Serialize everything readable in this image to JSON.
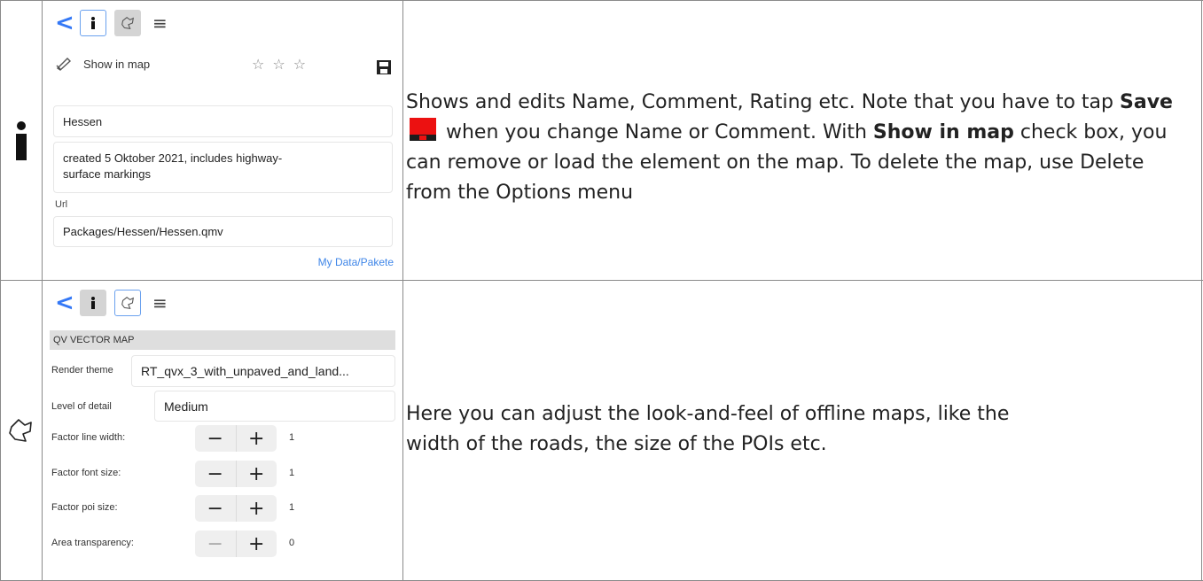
{
  "row1": {
    "toolbar": {
      "back": "<"
    },
    "show_in_map": "Show in map",
    "stars": [
      "☆",
      "☆",
      "☆"
    ],
    "name": "Hessen",
    "comment": "created 5 Oktober 2021, includes highway-surface markings",
    "url_label": "Url",
    "url": "Packages/Hessen/Hessen.qmv",
    "folder_link": "My Data/Pakete",
    "description": {
      "p1": "Shows and edits Name, Comment, Rating etc. Note that you have to tap ",
      "save": "Save",
      "p2": " when you change Name or Comment. With ",
      "show": "Show in map",
      "p3": " check box, you can remove or load the element on the map. To delete the map, use Delete from the Options menu"
    }
  },
  "row2": {
    "toolbar": {
      "back": "<"
    },
    "section": "QV VECTOR MAP",
    "render_theme_label": "Render theme",
    "render_theme_value": "RT_qvx_3_with_unpaved_and_land...",
    "lod_label": "Level of detail",
    "lod_value": "Medium",
    "steppers": [
      {
        "label": "Factor line width:",
        "value": "1"
      },
      {
        "label": "Factor font size:",
        "value": "1"
      },
      {
        "label": "Factor poi size:",
        "value": "1"
      },
      {
        "label": "Area transparency:",
        "value": "0"
      }
    ],
    "minus": "−",
    "plus": "+",
    "description": "Here you can adjust the look-and-feel of offline maps, like the width of the roads, the size of the POIs etc."
  },
  "colors": {
    "accent": "#3478f6",
    "save_red": "#ec1111",
    "grid": "#8a8a8a"
  },
  "icons": [
    "info-icon",
    "map-outline-icon",
    "hamburger-icon",
    "back-chevron-icon",
    "save-icon",
    "pen-icon",
    "star-icon"
  ]
}
